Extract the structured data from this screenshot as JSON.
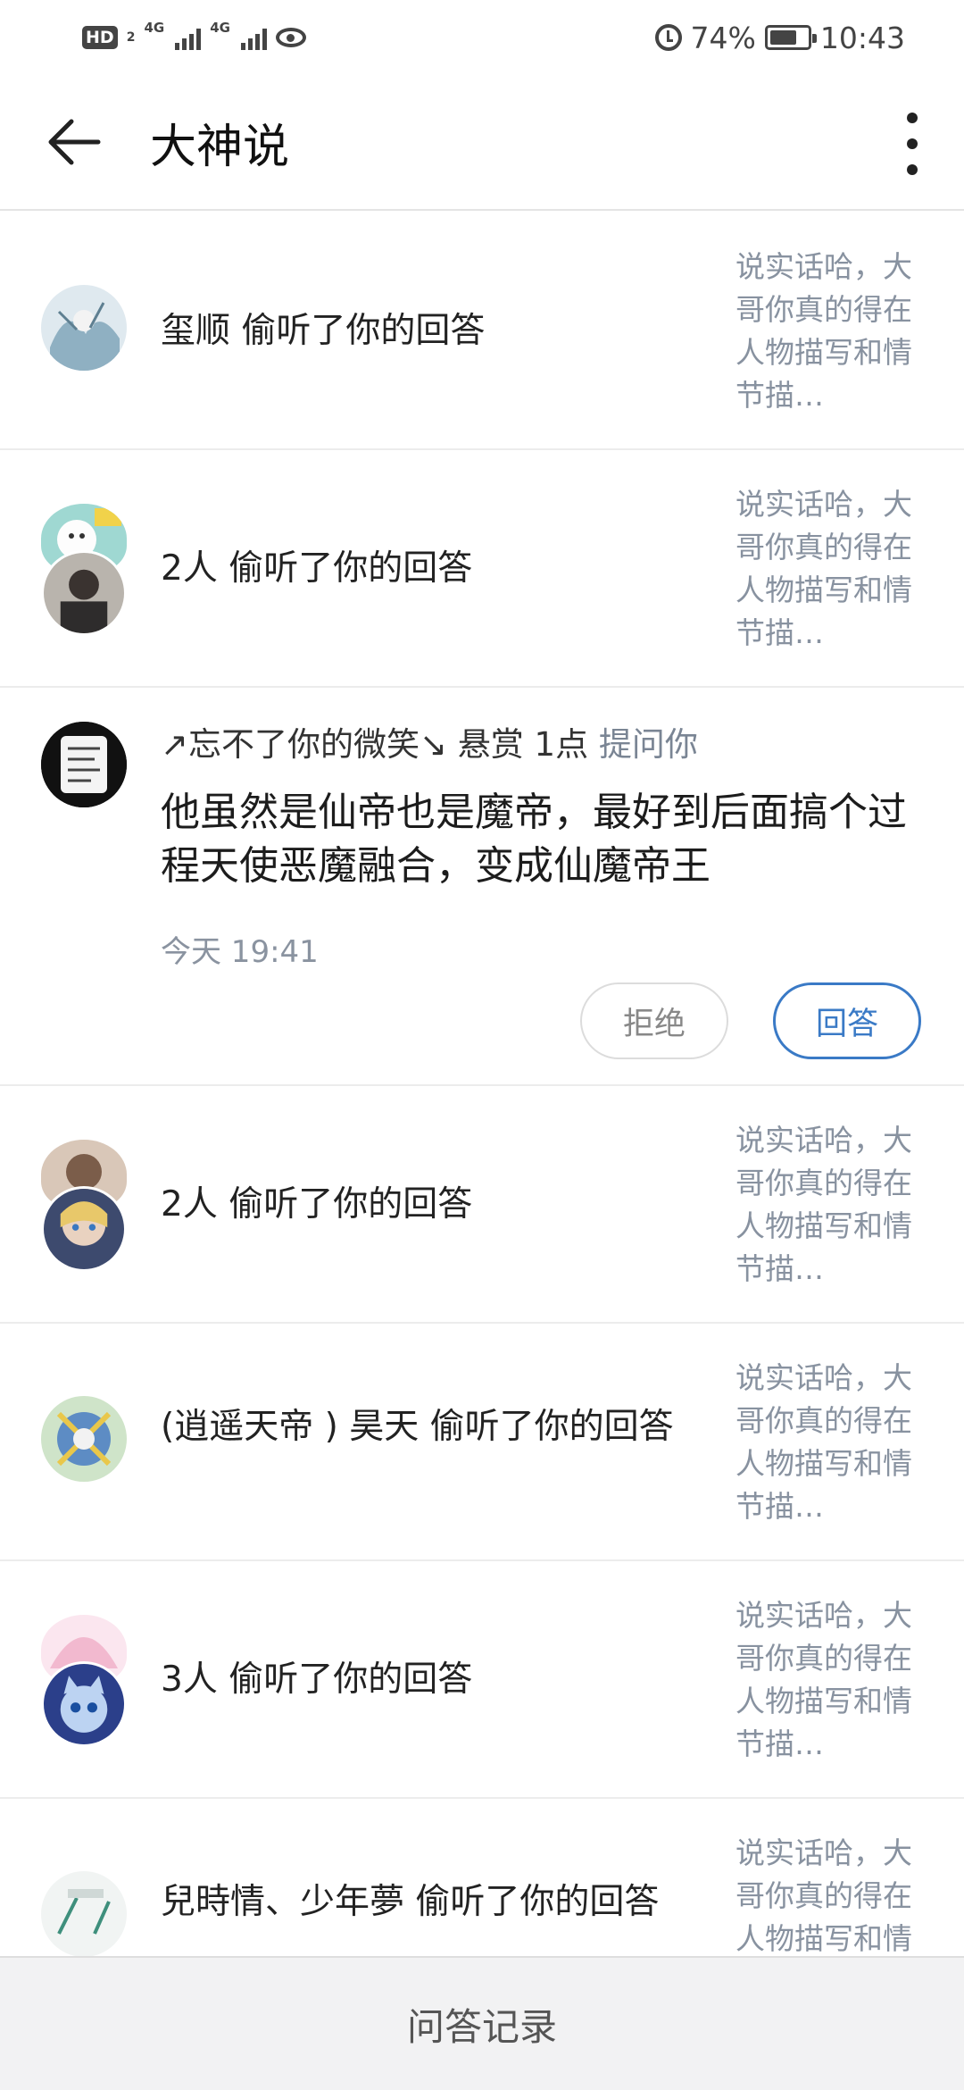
{
  "status_bar": {
    "hd": "HD",
    "sim1": "2",
    "net1": "4G",
    "net2": "4G",
    "battery": "74%",
    "battery_level": 0.74,
    "time": "10:43",
    "icons": [
      "hd-icon",
      "signal-icon",
      "signal-icon",
      "eye-icon",
      "alarm-icon",
      "battery-icon"
    ]
  },
  "header": {
    "title": "大神说",
    "back_icon": "back-arrow-icon",
    "more_icon": "more-vertical-icon"
  },
  "rows": [
    {
      "text": "玺顺 偷听了你的回答",
      "preview": "说实话哈，大哥你真的得在人物描写和情节描…"
    },
    {
      "text": "2人 偷听了你的回答",
      "preview": "说实话哈，大哥你真的得在人物描写和情节描…"
    },
    {
      "text": "2人 偷听了你的回答",
      "preview": "说实话哈，大哥你真的得在人物描写和情节描…"
    },
    {
      "text": "(逍遥天帝 ) 昊天 偷听了你的回答",
      "preview": "说实话哈，大哥你真的得在人物描写和情节描…"
    },
    {
      "text": "3人 偷听了你的回答",
      "preview": "说实话哈，大哥你真的得在人物描写和情节描…"
    },
    {
      "text": "兒時情、少年夢 偷听了你的回答",
      "preview": "说实话哈，大哥你真的得在人物描写和情节描…"
    }
  ],
  "question": {
    "user": "↗忘不了你的微笑↘",
    "reward": "悬赏 1点",
    "action": "提问你",
    "content": "他虽然是仙帝也是魔帝，最好到后面搞个过程天使恶魔融合，变成仙魔帝王",
    "time": "今天 19:41",
    "reject_label": "拒绝",
    "answer_label": "回答"
  },
  "bottom_bar": {
    "label": "问答记录"
  },
  "colors": {
    "accent": "#3a7ac6",
    "muted_text": "#8892a0",
    "divider": "#ececec"
  }
}
